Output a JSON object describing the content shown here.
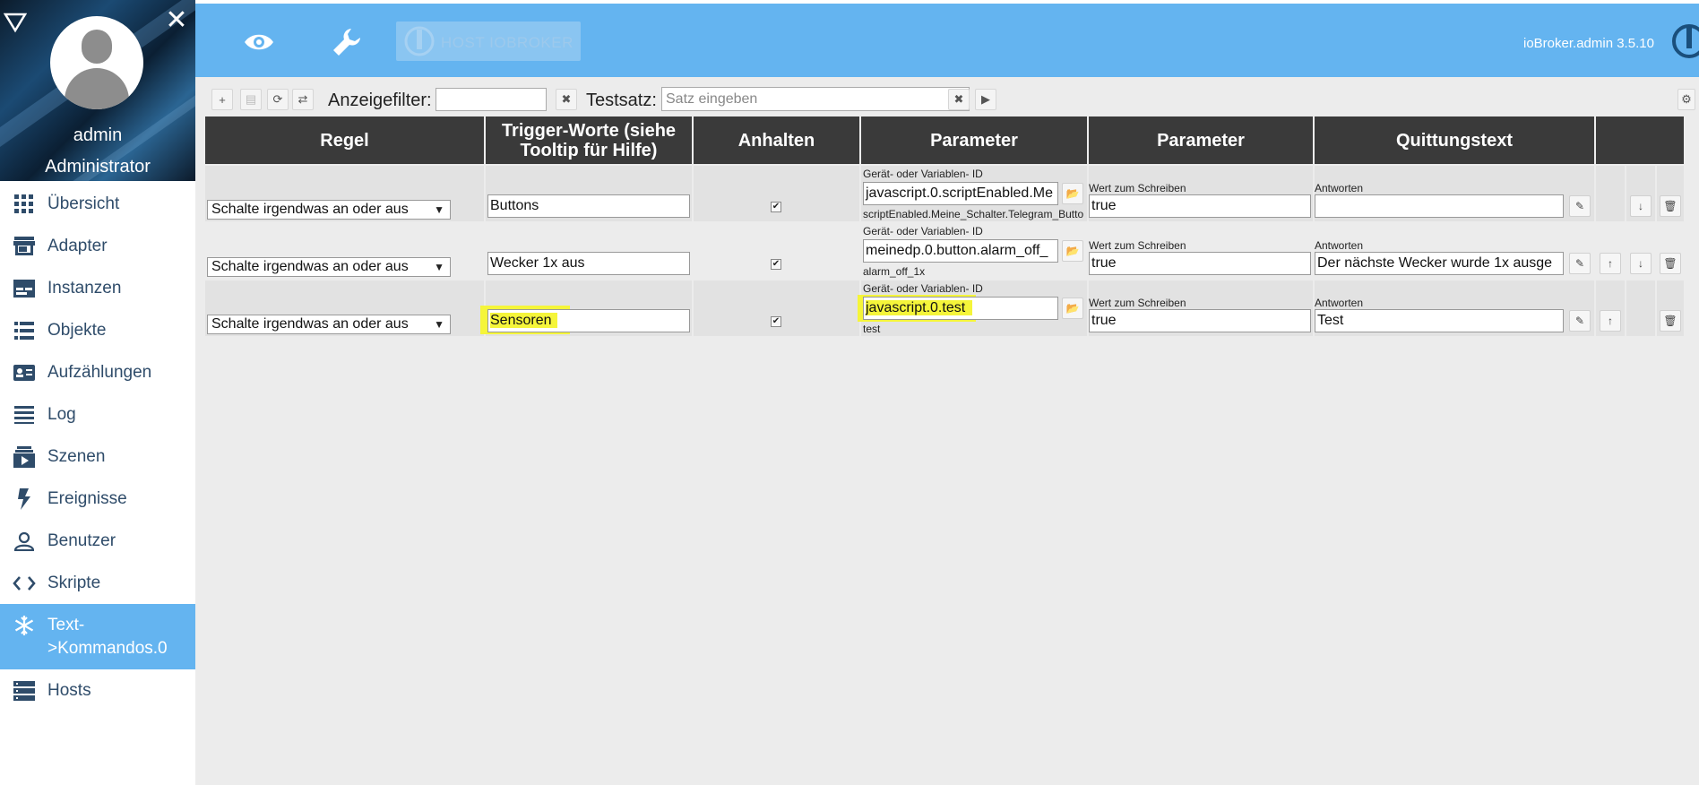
{
  "sidebar": {
    "user_name": "admin",
    "user_role": "Administrator",
    "items": [
      {
        "label": "Übersicht",
        "icon": "grid-icon"
      },
      {
        "label": "Adapter",
        "icon": "store-icon"
      },
      {
        "label": "Instanzen",
        "icon": "instances-icon"
      },
      {
        "label": "Objekte",
        "icon": "list-icon"
      },
      {
        "label": "Aufzählungen",
        "icon": "enum-icon"
      },
      {
        "label": "Log",
        "icon": "log-icon"
      },
      {
        "label": "Szenen",
        "icon": "scenes-icon"
      },
      {
        "label": "Ereignisse",
        "icon": "bolt-icon"
      },
      {
        "label": "Benutzer",
        "icon": "user-icon"
      },
      {
        "label": "Skripte",
        "icon": "code-icon"
      },
      {
        "label": "Text-\n>Kommandos.0",
        "label_line1": "Text-",
        "label_line2": ">Kommandos.0",
        "icon": "snowflake-icon",
        "active": true
      },
      {
        "label": "Hosts",
        "icon": "hosts-icon"
      }
    ]
  },
  "topbar": {
    "host_label": "HOST IOBROKER",
    "version": "ioBroker.admin 3.5.10",
    "accent_color": "#64b4f0"
  },
  "toolbar": {
    "filter_label": "Anzeigefilter:",
    "filter_value": "",
    "test_label": "Testsatz:",
    "test_placeholder": "Satz eingeben"
  },
  "table": {
    "headers": [
      "Regel",
      "Trigger-Worte (siehe Tooltip für Hilfe)",
      "Anhalten",
      "Parameter",
      "Parameter",
      "Quittungstext",
      ""
    ],
    "id_label": "Gerät- oder Variablen- ID",
    "write_label": "Wert zum Schreiben",
    "answer_label": "Antworten",
    "rows": [
      {
        "rule": "Schalte irgendwas an oder aus",
        "trigger": "Buttons",
        "stop": "✔",
        "id_value": "javascript.0.scriptEnabled.Me",
        "id_sub": "scriptEnabled.Meine_Schalter.Telegram_Butto",
        "write_value": "true",
        "answer": ""
      },
      {
        "rule": "Schalte irgendwas an oder aus",
        "trigger": "Wecker 1x aus",
        "stop": "✔",
        "id_value": "meinedp.0.button.alarm_off_",
        "id_sub": "alarm_off_1x",
        "write_value": "true",
        "answer": "Der nächste Wecker wurde 1x ausge"
      },
      {
        "rule": "Schalte irgendwas an oder aus",
        "trigger": "Sensoren",
        "stop": "✔",
        "id_value": "javascript.0.test",
        "id_sub": "test",
        "write_value": "true",
        "answer": "Test"
      }
    ]
  }
}
